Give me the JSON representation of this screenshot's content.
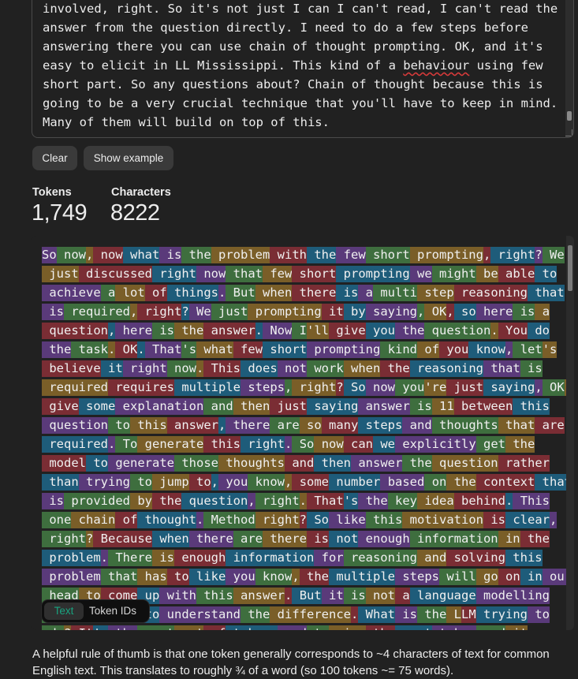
{
  "input": {
    "lines": [
      "involved, right. So it's not just I can I can't read, I can't read the",
      "answer from the question directly. I need to do a few steps before",
      "answering there you can use chain of thought prompting. OK, and it's",
      "easy to elicit in LL Mississippi. This kind of a ",
      "behaviour",
      " using few",
      "short part. So any questions about? Chain of thought because this is",
      "going to be a very crucial technique that you'll have to keep in mind.",
      "Many of them will build on top of this."
    ]
  },
  "buttons": {
    "clear": "Clear",
    "show_example": "Show example"
  },
  "stats": {
    "tokens_label": "Tokens",
    "tokens_value": "1,749",
    "characters_label": "Characters",
    "characters_value": "8222"
  },
  "token_lines": [
    [
      "So",
      " now",
      ",",
      " now",
      " what",
      " is",
      " the",
      " problem",
      " with",
      " the",
      " few",
      " short",
      " prompting",
      ",",
      " right",
      "?",
      " We"
    ],
    [
      " just",
      " discussed",
      " right",
      " now",
      " that",
      " few",
      " short",
      " prompting",
      " we",
      " might",
      " be",
      " able",
      " to"
    ],
    [
      " achieve",
      " a",
      " lot",
      " of",
      " things",
      ".",
      " But",
      " when",
      " there",
      " is",
      " a",
      " multi",
      " step",
      " reasoning",
      " that"
    ],
    [
      " is",
      " required",
      ",",
      " right",
      "?",
      " We",
      " just",
      " prompting",
      " it",
      " by",
      " saying",
      ",",
      " OK",
      ",",
      " so",
      " here",
      " is",
      " a"
    ],
    [
      " question",
      ",",
      " here",
      " is",
      " the",
      " answer",
      ".",
      " Now",
      " I",
      "'ll",
      " give",
      " you",
      " the",
      " question",
      ".",
      " You",
      " do"
    ],
    [
      " the",
      " task",
      ".",
      " OK",
      ".",
      " That",
      "'s",
      " what",
      " few",
      " short",
      " prompting",
      " kind",
      " of",
      " you",
      " know",
      ",",
      " let",
      "'s"
    ],
    [
      " believe",
      " it",
      " right",
      " now",
      ".",
      " This",
      " does",
      " not",
      " work",
      " when",
      " the",
      " reasoning",
      " that",
      " is"
    ],
    [
      " required",
      " requires",
      " multiple",
      " steps",
      ",",
      " right",
      "?",
      " So",
      " now",
      " you",
      "'re",
      " just",
      " saying",
      ",",
      " OK",
      ","
    ],
    [
      " give",
      " some",
      " explanation",
      " and",
      " then",
      " just",
      " saying",
      " answer",
      " is",
      " 11",
      " between",
      " this"
    ],
    [
      " question",
      " to",
      " this",
      " answer",
      ",",
      " there",
      " are",
      " so",
      " many",
      " steps",
      " and",
      " thoughts",
      " that",
      " are"
    ],
    [
      " required",
      ".",
      " To",
      " generate",
      " this",
      " right",
      ".",
      " So",
      " now",
      " can",
      " we",
      " explicitly",
      " get",
      " the"
    ],
    [
      " model",
      " to",
      " generate",
      " those",
      " thoughts",
      " and",
      " then",
      " answer",
      " the",
      " question",
      " rather"
    ],
    [
      " than",
      " trying",
      " to",
      " jump",
      " to",
      ",",
      " you",
      " know",
      ",",
      " some",
      " number",
      " based",
      " on",
      " the",
      " context",
      " that"
    ],
    [
      " is",
      " provided",
      " by",
      " the",
      " question",
      ",",
      " right",
      ".",
      " That",
      "'s",
      " the",
      " key",
      " idea",
      " behind",
      ".",
      " This"
    ],
    [
      " one",
      " chain",
      " of",
      " thought",
      ".",
      " Method",
      " right",
      "?",
      " So",
      " like",
      " this",
      " motivation",
      " is",
      " clear",
      ","
    ],
    [
      " right",
      "?",
      " Because",
      " when",
      " there",
      " are",
      " there",
      " is",
      " not",
      " enough",
      " information",
      " in",
      " the"
    ],
    [
      " problem",
      ".",
      " There",
      " is",
      " enough",
      " information",
      " for",
      " reasoning",
      " and",
      " solving",
      " this"
    ],
    [
      " problem",
      " that",
      " has",
      " to",
      " like",
      " you",
      " know",
      ",",
      " the",
      " multiple",
      " steps",
      " will",
      " go",
      " on",
      " in",
      " our"
    ],
    [
      " head",
      " to",
      " come",
      " up",
      " with",
      " this",
      " answer",
      ".",
      " But",
      " it",
      " is",
      " not",
      " a",
      " language",
      " modelling"
    ],
    [
      " that",
      " we",
      " need",
      " to",
      " understand",
      " the",
      " difference",
      ".",
      " What",
      " is",
      " the",
      " L",
      "LM",
      " trying",
      " to"
    ],
    [
      " do",
      "?",
      " It",
      "'s",
      " the",
      " next",
      " set",
      " of",
      " tokens",
      " and",
      " to",
      " give",
      " the",
      " next",
      " token",
      " and",
      " it"
    ]
  ],
  "view_toggle": {
    "text": "Text",
    "token_ids": "Token IDs"
  },
  "footer": {
    "text": "A helpful rule of thumb is that one token generally corresponds to ~4 characters of text for common English text. This translates to roughly ¾ of a word (so 100 tokens ~= 75 words)."
  }
}
